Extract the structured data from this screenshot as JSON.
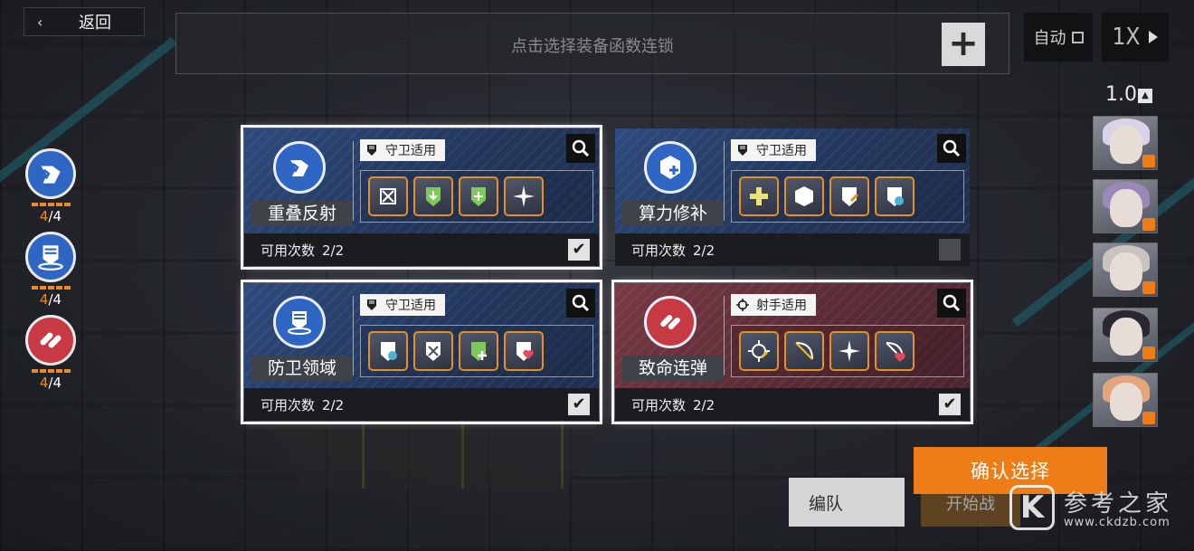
{
  "top_bar": {
    "back_label": "返回",
    "chain_prompt": "点击选择装备函数连锁",
    "auto_label": "自动",
    "speed_label": "1X",
    "zoom_value": "1.0"
  },
  "left_rail": [
    {
      "name": "overlap-reflection",
      "current": "4",
      "max": "/4",
      "color": "#2f66c4"
    },
    {
      "name": "defense-domain",
      "current": "4",
      "max": "/4",
      "color": "#2f66c4"
    },
    {
      "name": "deadly-barrage",
      "current": "4",
      "max": "/4",
      "color": "#c73a44"
    }
  ],
  "cards": [
    {
      "name": "重叠反射",
      "class_tag": "守卫适用",
      "uses_label": "可用次数",
      "uses_value": "2/2",
      "selected": true,
      "theme": "blue",
      "icon": "shield-reflect-icon",
      "chips": [
        "crossed-square-icon",
        "shield-down-icon",
        "shield-plus-icon",
        "spark-icon"
      ]
    },
    {
      "name": "算力修补",
      "class_tag": "守卫适用",
      "uses_label": "可用次数",
      "uses_value": "2/2",
      "selected": false,
      "theme": "blue",
      "icon": "hex-plus-icon",
      "chips": [
        "cross-heal-icon",
        "hexagon-icon",
        "shield-edit-icon",
        "shield-refresh-icon"
      ]
    },
    {
      "name": "防卫领域",
      "class_tag": "守卫适用",
      "uses_label": "可用次数",
      "uses_value": "2/2",
      "selected": true,
      "theme": "blue",
      "icon": "shield-domain-icon",
      "chips": [
        "shield-drop-icon",
        "shield-cross-icon",
        "shield-heal-icon",
        "shield-heart-icon"
      ]
    },
    {
      "name": "致命连弹",
      "class_tag": "射手适用",
      "uses_label": "可用次数",
      "uses_value": "2/2",
      "selected": true,
      "theme": "red",
      "icon": "bullets-icon",
      "chips": [
        "crosshair-icon",
        "bow-icon",
        "spark-icon",
        "bow-heart-icon"
      ]
    }
  ],
  "bottom": {
    "confirm_label": "确认选择",
    "team_label": "编队",
    "start_label": "开始战"
  },
  "watermark": {
    "logo": "K",
    "title": "参考之家",
    "url": "www.ckdzb.com"
  },
  "colors": {
    "accent_orange": "#ef7d17",
    "pip_orange": "#f08b24",
    "card_blue": "#2e4a7d",
    "card_red": "#7a3a44"
  }
}
